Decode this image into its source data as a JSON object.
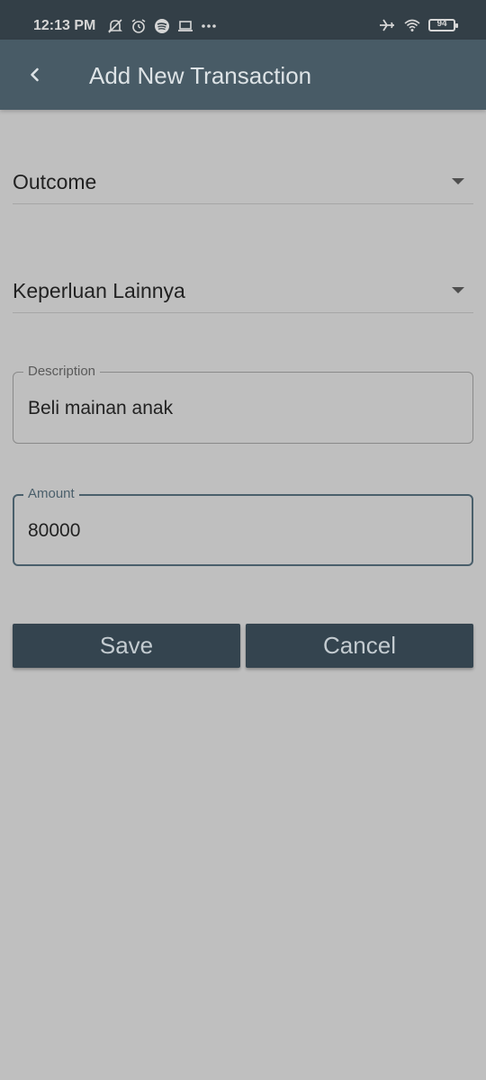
{
  "status_bar": {
    "time": "12:13 PM",
    "battery": "94",
    "icons_left": [
      "mute-icon",
      "alarm-icon",
      "spotify-icon",
      "laptop-icon",
      "more-dots-icon"
    ],
    "icons_right": [
      "airplane-icon",
      "wifi-icon",
      "battery-icon"
    ]
  },
  "app_bar": {
    "title": "Add New Transaction",
    "back_icon": "chevron-left-icon"
  },
  "form": {
    "type_dropdown": {
      "value": "Outcome"
    },
    "category_dropdown": {
      "value": "Keperluan Lainnya"
    },
    "description": {
      "label": "Description",
      "value": "Beli mainan anak"
    },
    "amount": {
      "label": "Amount",
      "value": "80000"
    }
  },
  "buttons": {
    "save": "Save",
    "cancel": "Cancel"
  },
  "colors": {
    "background": "#bfbfbf",
    "status_bar": "#333f47",
    "app_bar": "#485b66",
    "button": "#34444f",
    "focused_border": "#4a5f6b"
  }
}
